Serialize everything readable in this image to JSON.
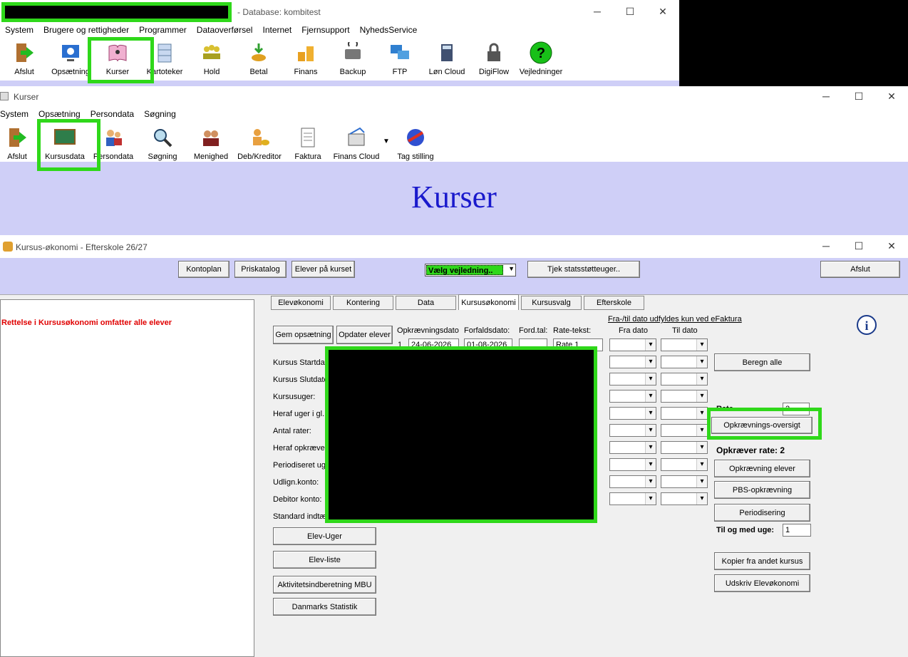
{
  "main_window": {
    "title_suffix": "- Database: kombitest",
    "menu": [
      "System",
      "Brugere og rettigheder",
      "Programmer",
      "Dataoverførsel",
      "Internet",
      "Fjernsupport",
      "NyhedsService"
    ],
    "toolbar": [
      "Afslut",
      "Opsætning",
      "Kurser",
      "Kartoteker",
      "Hold",
      "Betal",
      "Finans",
      "Backup",
      "FTP",
      "Løn Cloud",
      "DigiFlow",
      "Vejledninger"
    ]
  },
  "kurser_window": {
    "title": "Kurser",
    "menu": [
      "System",
      "Opsætning",
      "Persondata",
      "Søgning"
    ],
    "toolbar": [
      "Afslut",
      "Kursusdata",
      "Persondata",
      "Søgning",
      "Menighed",
      "Deb/Kreditor",
      "Faktura",
      "Finans Cloud",
      "Tag stilling"
    ],
    "banner": "Kurser"
  },
  "okonomi_window": {
    "title": "Kursus-økonomi - Efterskole 26/27",
    "top_buttons": {
      "kontoplan": "Kontoplan",
      "priskatalog": "Priskatalog",
      "elever": "Elever på kurset",
      "vejledning": "Vælg vejledning..",
      "tjek": "Tjek statsstøtteuger..",
      "afslut": "Afslut"
    },
    "warning": "Rettelse i Kursusøkonomi omfatter alle elever",
    "tabs": [
      "Elevøkonomi",
      "Kontering",
      "Data",
      "Kursusøkonomi",
      "Kursusvalg",
      "Efterskole"
    ],
    "gem": "Gem opsætning",
    "opdater": "Opdater elever",
    "col_headers": {
      "opkr": "Opkrævningsdato",
      "forfald": "Forfaldsdato:",
      "fordtal": "Ford.tal:",
      "ratetekst": "Rate-tekst:",
      "fra": "Fra dato",
      "til": "Til dato",
      "efaktura": "Fra-/til dato udfyldes kun ved eFaktura"
    },
    "row1": {
      "num": "1",
      "opkr": "24-06-2026",
      "forfald": "01-08-2026",
      "ratetekst": "Rate 1"
    },
    "left_labels": [
      "Kursus Startdato",
      "Kursus Slutdato",
      "Kursusuger:",
      "Heraf uger i gl. år",
      "Antal rater:",
      "Heraf opkrævet",
      "Periodiseret uger",
      "Udlign.konto:",
      "Debitor konto:",
      "Standard indtægt"
    ],
    "left_buttons": [
      "Elev-Uger",
      "Elev-liste",
      "Aktivitetsindberetning MBU",
      "Danmarks Statistik"
    ],
    "right": {
      "beregn": "Beregn alle",
      "rate_label": "Rate",
      "rate_value": "2",
      "oversigt": "Opkrævnings-oversigt",
      "opkraever": "Opkræver rate: 2",
      "opk_elever": "Opkrævning elever",
      "pbs": "PBS-opkrævning",
      "periodisering": "Periodisering",
      "tilogmed": "Til og med uge:",
      "tilogmed_value": "1",
      "kopier": "Kopier fra andet kursus",
      "udskriv": "Udskriv Elevøkonomi"
    }
  },
  "colors": {
    "highlight": "#2fd81a",
    "banner_bg": "#cfcff7",
    "banner_text": "#1a1acc",
    "warning": "#e00000"
  }
}
